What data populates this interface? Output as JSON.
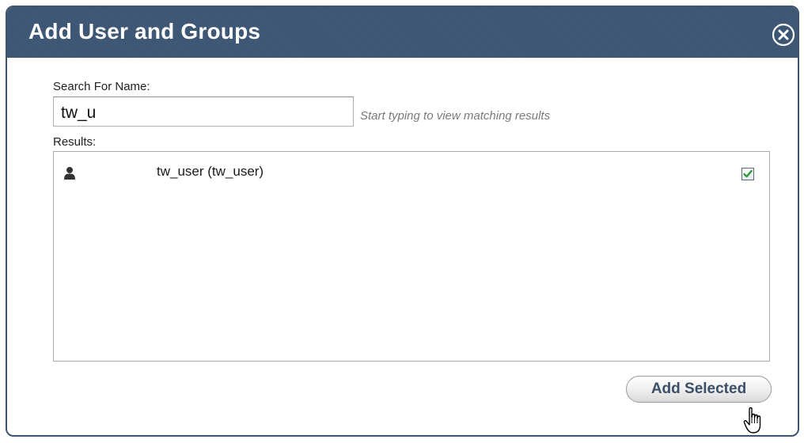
{
  "dialog": {
    "title": "Add User and Groups",
    "close_icon": "close-icon"
  },
  "search": {
    "label": "Search For Name:",
    "value": "tw_u",
    "hint": "Start typing to view matching results"
  },
  "results": {
    "label": "Results:",
    "items": [
      {
        "icon": "user-icon",
        "text": "tw_user (tw_user)",
        "checked": true
      }
    ]
  },
  "actions": {
    "add_selected_label": "Add Selected"
  },
  "colors": {
    "titlebar": "#3b5573",
    "button_text": "#3b5068",
    "checkmark": "#2e9a3a"
  }
}
